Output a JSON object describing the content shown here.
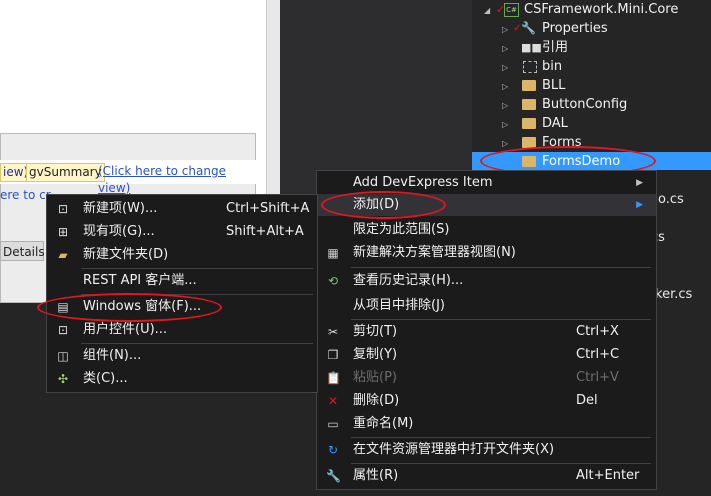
{
  "designer": {
    "token_view": "iew)",
    "token_summary": "gvSummary",
    "link_change_view": "(Click here to change view)",
    "link_create": "ere to cr",
    "details_tab": "Details"
  },
  "solution_explorer": {
    "project": "CSFramework.Mini.Core",
    "items": [
      {
        "label": "Properties"
      },
      {
        "label": "引用"
      },
      {
        "label": "bin"
      },
      {
        "label": "BLL"
      },
      {
        "label": "ButtonConfig"
      },
      {
        "label": "DAL"
      },
      {
        "label": "Forms"
      },
      {
        "label": "FormsDemo"
      }
    ],
    "partial_files": [
      "o.cs",
      "cs",
      "ker.cs"
    ]
  },
  "context_menu": {
    "items": [
      {
        "label": "Add DevExpress Item",
        "shortcut": ""
      },
      {
        "label": "添加(D)",
        "shortcut": ""
      },
      {
        "label": "限定为此范围(S)",
        "shortcut": ""
      },
      {
        "label": "新建解决方案管理器视图(N)",
        "shortcut": ""
      },
      {
        "label": "查看历史记录(H)...",
        "shortcut": ""
      },
      {
        "label": "从项目中排除(J)",
        "shortcut": ""
      },
      {
        "label": "剪切(T)",
        "shortcut": "Ctrl+X"
      },
      {
        "label": "复制(Y)",
        "shortcut": "Ctrl+C"
      },
      {
        "label": "粘贴(P)",
        "shortcut": "Ctrl+V"
      },
      {
        "label": "删除(D)",
        "shortcut": "Del"
      },
      {
        "label": "重命名(M)",
        "shortcut": ""
      },
      {
        "label": "在文件资源管理器中打开文件夹(X)",
        "shortcut": ""
      },
      {
        "label": "属性(R)",
        "shortcut": "Alt+Enter"
      }
    ]
  },
  "add_submenu": {
    "items": [
      {
        "label": "新建项(W)...",
        "shortcut": "Ctrl+Shift+A"
      },
      {
        "label": "现有项(G)...",
        "shortcut": "Shift+Alt+A"
      },
      {
        "label": "新建文件夹(D)",
        "shortcut": ""
      },
      {
        "label": "REST API 客户端...",
        "shortcut": ""
      },
      {
        "label": "Windows 窗体(F)...",
        "shortcut": ""
      },
      {
        "label": "用户控件(U)...",
        "shortcut": ""
      },
      {
        "label": "组件(N)...",
        "shortcut": ""
      },
      {
        "label": "类(C)...",
        "shortcut": ""
      }
    ]
  },
  "colors": {
    "selection": "#3399ff",
    "annotation": "#e0171e",
    "menu_bg": "#1b1b1c"
  }
}
